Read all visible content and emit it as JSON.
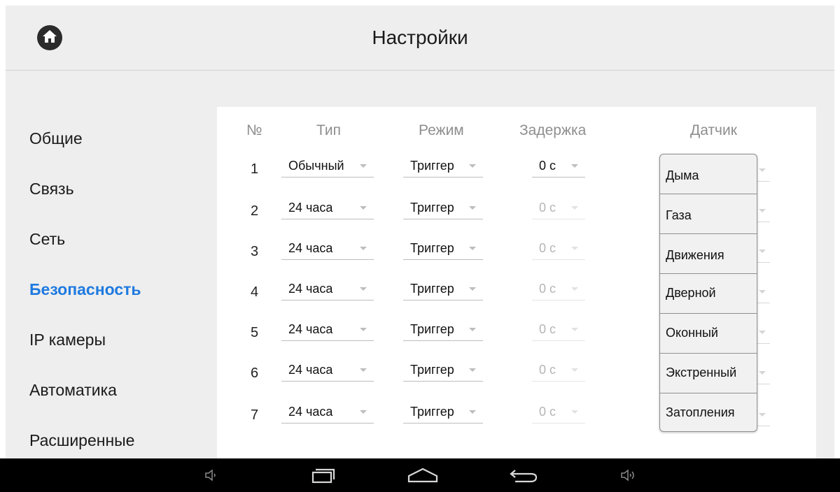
{
  "header": {
    "title": "Настройки",
    "home_icon": "home-icon"
  },
  "sidebar": {
    "items": [
      {
        "label": "Общие",
        "active": false
      },
      {
        "label": "Связь",
        "active": false
      },
      {
        "label": "Сеть",
        "active": false
      },
      {
        "label": "Безопасность",
        "active": true
      },
      {
        "label": "IP камеры",
        "active": false
      },
      {
        "label": "Автоматика",
        "active": false
      },
      {
        "label": "Расширенные",
        "active": false
      }
    ],
    "active_color": "#1f7ae0"
  },
  "table": {
    "headers": {
      "num": "№",
      "type": "Тип",
      "mode": "Режим",
      "delay": "Задержка",
      "sensor": "Датчик"
    },
    "rows": [
      {
        "num": "1",
        "type": "Обычный",
        "mode": "Триггер",
        "delay": "0 с",
        "delay_enabled": true
      },
      {
        "num": "2",
        "type": "24 часа",
        "mode": "Триггер",
        "delay": "0 с",
        "delay_enabled": false
      },
      {
        "num": "3",
        "type": "24 часа",
        "mode": "Триггер",
        "delay": "0 с",
        "delay_enabled": false
      },
      {
        "num": "4",
        "type": "24 часа",
        "mode": "Триггер",
        "delay": "0 с",
        "delay_enabled": false
      },
      {
        "num": "5",
        "type": "24 часа",
        "mode": "Триггер",
        "delay": "0 с",
        "delay_enabled": false
      },
      {
        "num": "6",
        "type": "24 часа",
        "mode": "Триггер",
        "delay": "0 с",
        "delay_enabled": false
      },
      {
        "num": "7",
        "type": "24 часа",
        "mode": "Триггер",
        "delay": "0 с",
        "delay_enabled": false
      }
    ]
  },
  "sensor_dropdown": {
    "options": [
      "Дыма",
      "Газа",
      "Движения",
      "Дверной",
      "Оконный",
      "Экстренный",
      "Затопления"
    ]
  },
  "navbar": {
    "icons": [
      "volume-down-icon",
      "recent-apps-icon",
      "home-nav-icon",
      "back-icon",
      "volume-up-icon"
    ]
  }
}
